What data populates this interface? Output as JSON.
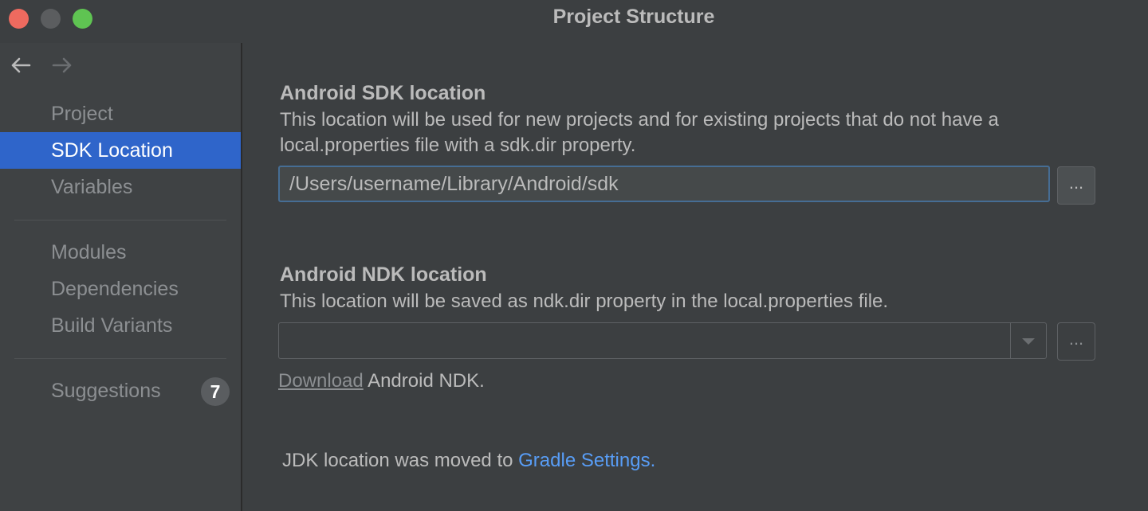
{
  "window": {
    "title": "Project Structure"
  },
  "sidebar": {
    "items": [
      {
        "label": "Project"
      },
      {
        "label": "SDK Location"
      },
      {
        "label": "Variables"
      },
      {
        "label": "Modules"
      },
      {
        "label": "Dependencies"
      },
      {
        "label": "Build Variants"
      },
      {
        "label": "Suggestions",
        "badge": "7"
      }
    ]
  },
  "sdk": {
    "heading": "Android SDK location",
    "description": "This location will be used for new projects and for existing projects that do not have a local.properties file with a sdk.dir property.",
    "path_value": "/Users/username/Library/Android/sdk",
    "browse_label": "..."
  },
  "ndk": {
    "heading": "Android NDK location",
    "description": "This location will be saved as ndk.dir property in the local.properties file.",
    "path_value": "",
    "browse_label": "...",
    "download_link": "Download",
    "download_suffix": " Android NDK."
  },
  "jdk": {
    "note": "JDK location was moved to ",
    "link": "Gradle Settings."
  },
  "colors": {
    "selection": "#2f65ca",
    "link": "#589df6",
    "close": "#ee6a5f",
    "maximize": "#5fc452"
  }
}
